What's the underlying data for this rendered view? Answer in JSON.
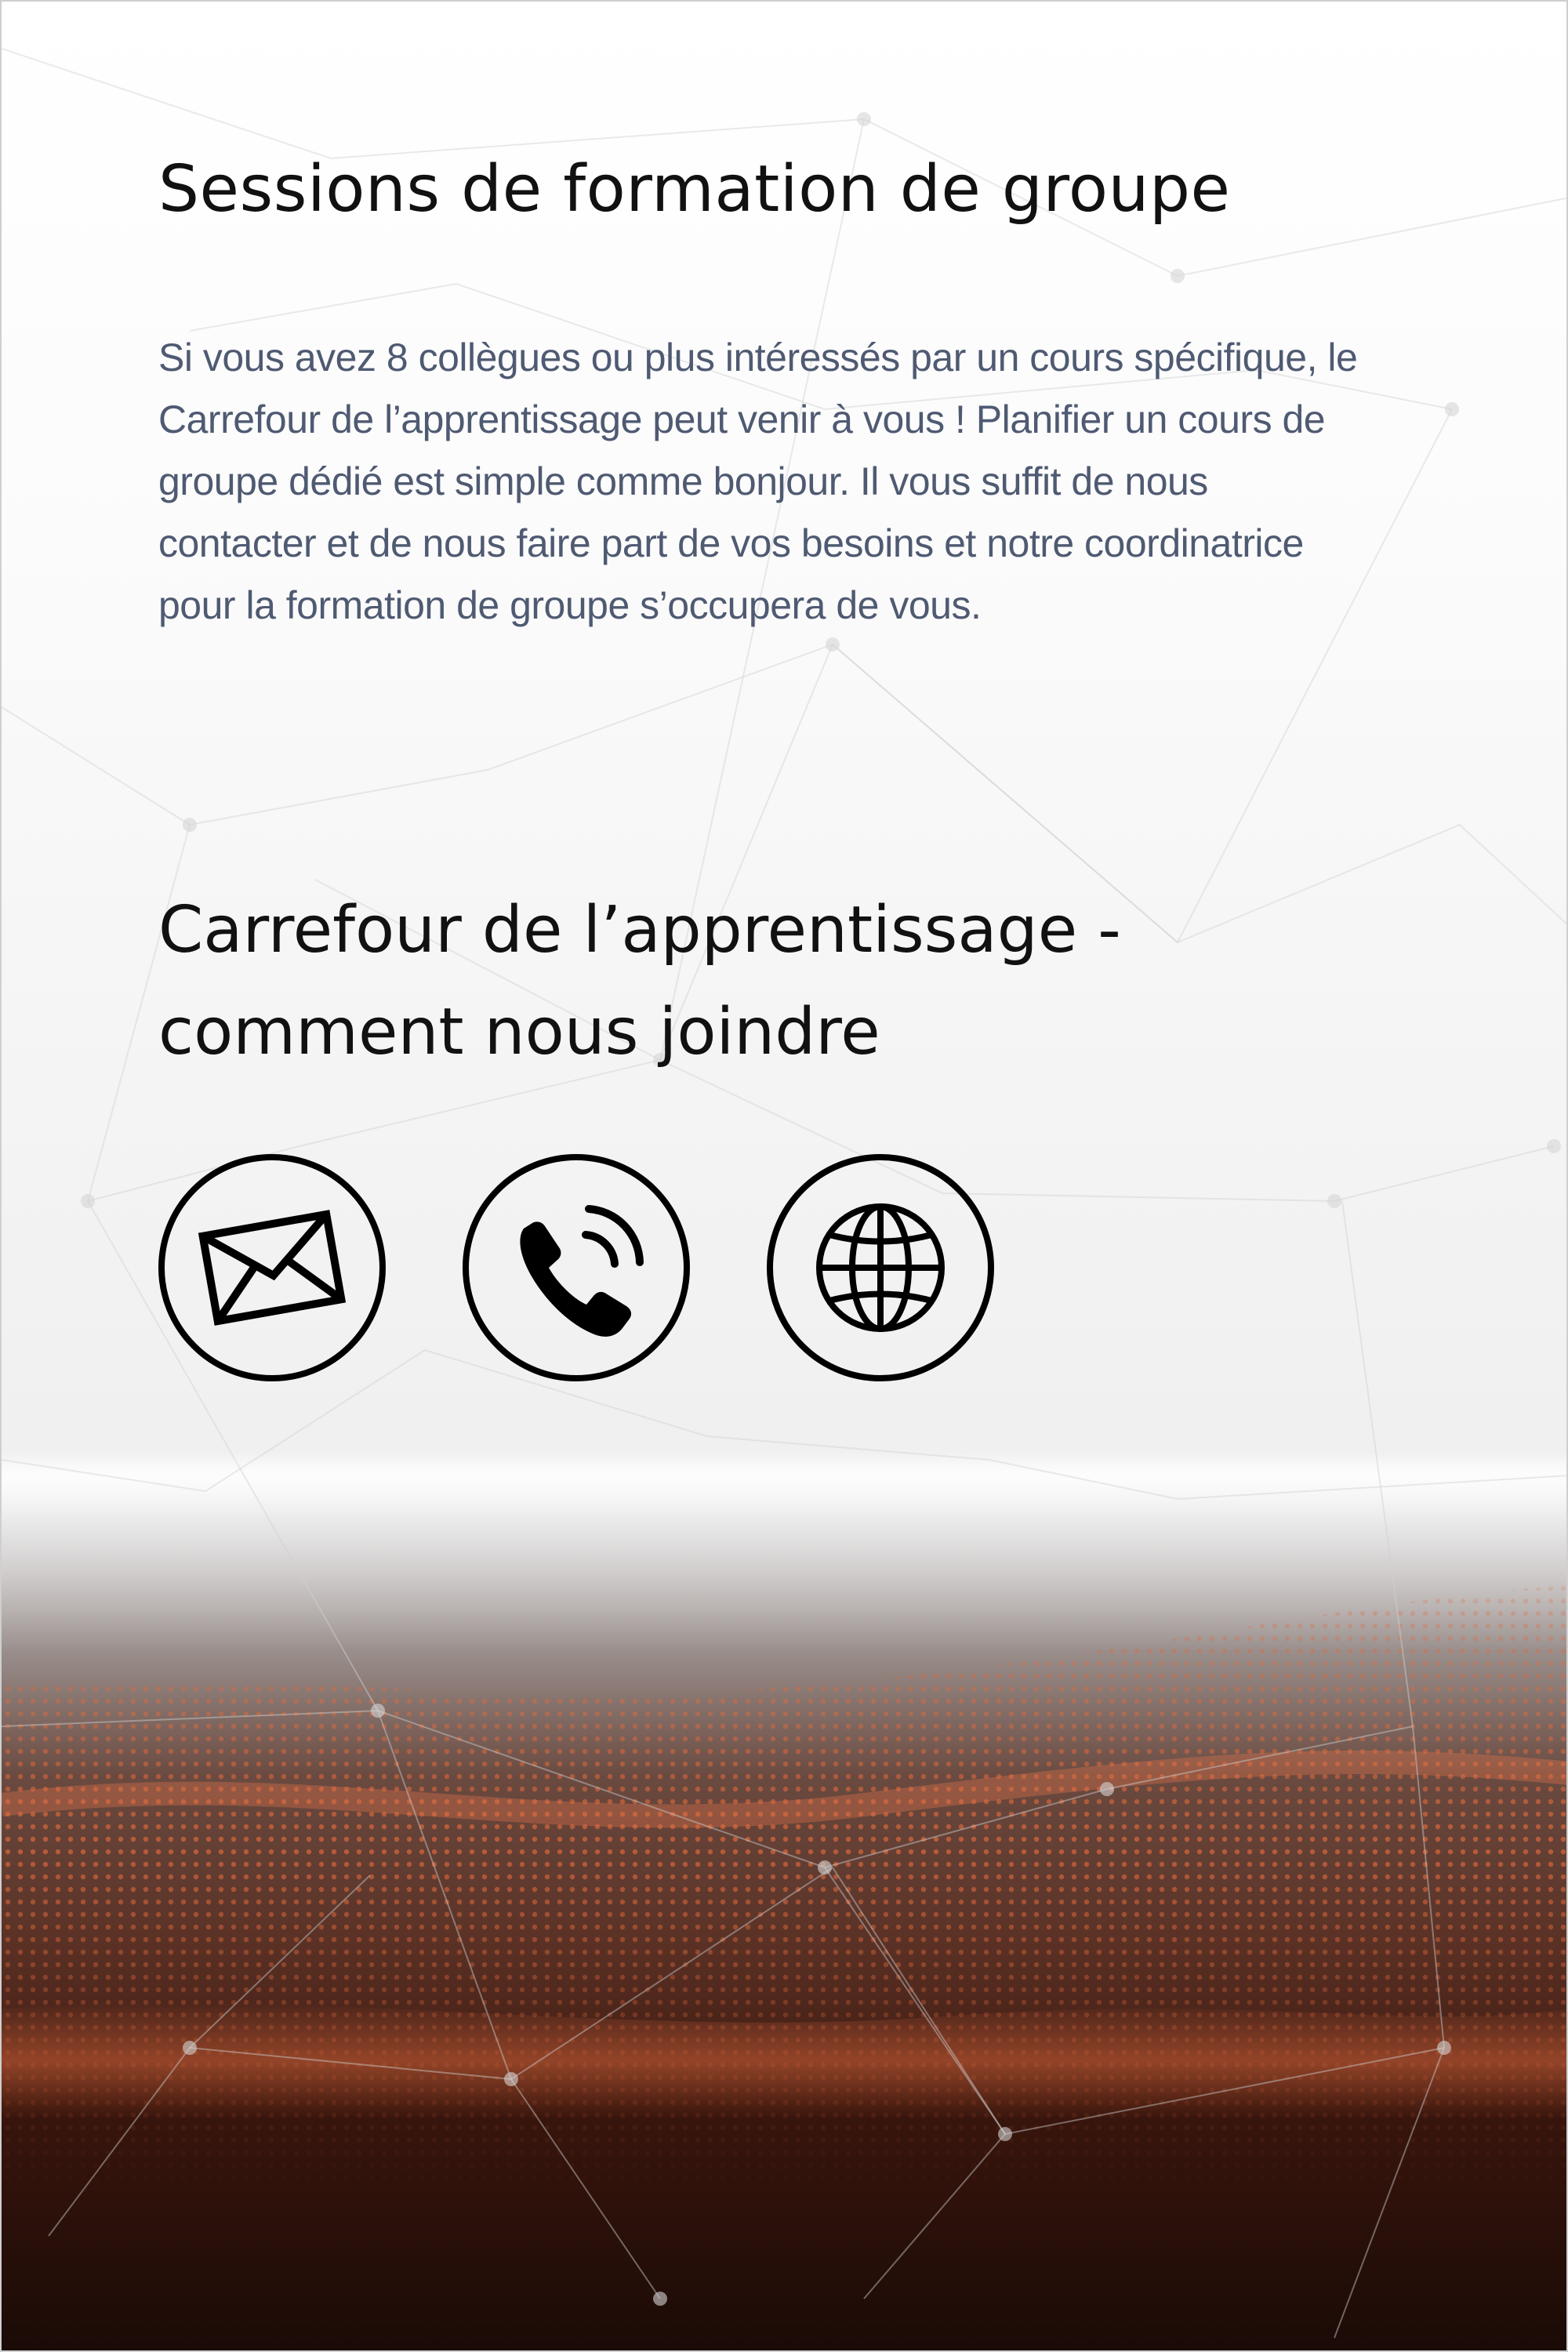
{
  "section_training": {
    "title": "Sessions de formation de groupe",
    "body": "Si vous avez 8 collègues ou plus intéressés par un cours spécifique, le\nCarrefour de l’apprentissage peut venir à vous !  Planifier un cours de\ngroupe dédié est simple comme bonjour.  Il vous suffit de nous\ncontacter et de nous faire part de vos besoins et notre coordinatrice\npour la formation de groupe s’occupera de vous."
  },
  "section_contact": {
    "title": "Carrefour de l’apprentissage - comment nous joindre",
    "icons": [
      "envelope-icon",
      "phone-icon",
      "globe-icon"
    ]
  },
  "colors": {
    "heading": "#111111",
    "body_text": "#4f5a72",
    "accent_orange": "#c8532f",
    "footer_dark": "#1e0c08"
  }
}
